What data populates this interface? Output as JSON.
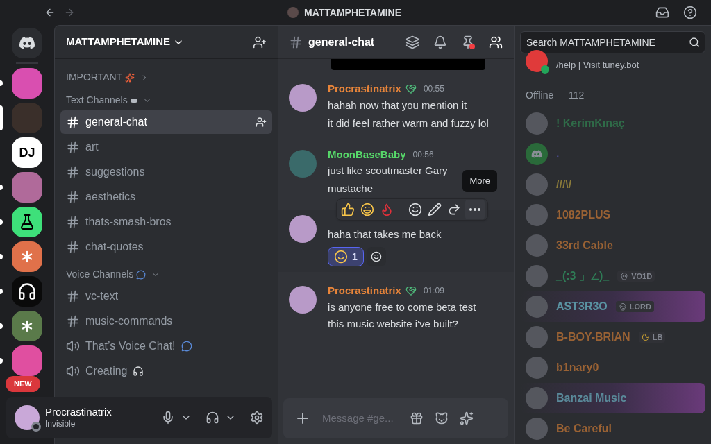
{
  "titlebar": {
    "title": "MATTAMPHETAMINE"
  },
  "servers": [
    {
      "color": "#2b2d31",
      "kind": "home",
      "unread": false,
      "selected": false
    },
    {
      "color": "#d94fb0",
      "kind": "picture",
      "unread": true,
      "selected": false
    },
    {
      "color": "#3a2f2a",
      "kind": "picture",
      "unread": false,
      "selected": true
    },
    {
      "color": "#ffffff",
      "kind": "label",
      "label": "DJ",
      "unread": false,
      "selected": false
    },
    {
      "color": "#b06a9a",
      "kind": "picture",
      "unread": true,
      "selected": false
    },
    {
      "color": "#3ee07a",
      "kind": "flask",
      "unread": true,
      "selected": false
    },
    {
      "color": "#e0714a",
      "kind": "burst",
      "unread": true,
      "selected": false
    },
    {
      "color": "#0a0a0a",
      "kind": "headphones",
      "unread": true,
      "selected": false
    },
    {
      "color": "#5a7a4a",
      "kind": "burst",
      "unread": true,
      "selected": false
    },
    {
      "color": "#e04fa0",
      "kind": "picture",
      "unread": true,
      "selected": false,
      "badge": "NEW"
    }
  ],
  "sidebar": {
    "server_name": "MATTAMPHETAMINE",
    "sections": [
      {
        "title": "IMPORTANT",
        "expanded": false
      },
      {
        "title": "Text Channels",
        "expanded": true,
        "channels": [
          {
            "name": "general-chat",
            "kind": "text",
            "selected": true
          },
          {
            "name": "art",
            "kind": "text",
            "selected": false
          },
          {
            "name": "suggestions",
            "kind": "text",
            "selected": false
          },
          {
            "name": "aesthetics",
            "kind": "text",
            "selected": false
          },
          {
            "name": "thats-smash-bros",
            "kind": "text",
            "selected": false
          },
          {
            "name": "chat-quotes",
            "kind": "text",
            "selected": false
          }
        ]
      },
      {
        "title": "Voice Channels",
        "expanded": true,
        "channels": [
          {
            "name": "vc-text",
            "kind": "text",
            "selected": false
          },
          {
            "name": "music-commands",
            "kind": "text",
            "selected": false
          },
          {
            "name": "That’s Voice Chat!",
            "kind": "voice",
            "selected": false
          },
          {
            "name": "Creating",
            "kind": "voice",
            "selected": false
          }
        ]
      }
    ],
    "user": {
      "name": "Procrastinatrix",
      "status": "Invisible"
    }
  },
  "chat": {
    "channel": "general-chat",
    "pin_alert": true,
    "messages": [
      {
        "author": "Procrastinatrix",
        "color": "#e8853a",
        "time": "00:55",
        "hovered": false,
        "lines": [
          "hahah now that you mention it",
          "it did feel rather warm and fuzzy lol"
        ]
      },
      {
        "author": "MoonBaseBaby",
        "color": "#57d96a",
        "time": "00:56",
        "hovered": false,
        "lines": [
          "just like scoutmaster Gary",
          "mustache"
        ]
      },
      {
        "hovered": true,
        "lines": [
          "haha that takes me back"
        ],
        "reactions": [
          {
            "count": "1",
            "reacted": true
          }
        ]
      },
      {
        "author": "Procrastinatrix",
        "color": "#e8853a",
        "time": "01:09",
        "hovered": false,
        "lines": [
          "is anyone free to come beta test this music website i've built?"
        ]
      }
    ],
    "tooltip": "More",
    "input": {
      "placeholder": "Message #ge..."
    }
  },
  "members": {
    "search": {
      "placeholder": "Search MATTAMPHETAMINE"
    },
    "bot_status": "/help | Visit tuney.bot",
    "group": "Offline — 112",
    "list": [
      {
        "name": "! KerimKınaç",
        "color": "#2f6b48",
        "highlighted": false,
        "kind": "photo"
      },
      {
        "name": ".",
        "color": "#4a4a8a",
        "highlighted": false,
        "kind": "logo"
      },
      {
        "name": "///\\/",
        "color": "#8a7a3a",
        "highlighted": false,
        "kind": "photo"
      },
      {
        "name": "1082PLUS",
        "color": "#9a6234",
        "highlighted": false,
        "kind": "photo"
      },
      {
        "name": "33rd Cable",
        "color": "#9a6234",
        "highlighted": false,
        "kind": "photo"
      },
      {
        "name": "_(:3 」∠)_",
        "color": "#2f7a55",
        "highlighted": false,
        "kind": "photo",
        "tag": {
          "kind": "skull",
          "label": "VO1D"
        }
      },
      {
        "name": "AST3R3O",
        "color": "#5a93a2",
        "highlighted": true,
        "kind": "photo",
        "tag": {
          "kind": "skull",
          "label": "LORD"
        }
      },
      {
        "name": "B-BOY-BRIAN",
        "color": "#9a6234",
        "highlighted": false,
        "kind": "photo",
        "tag": {
          "kind": "moon",
          "label": "LB"
        }
      },
      {
        "name": "b1nary0",
        "color": "#9a6234",
        "highlighted": false,
        "kind": "photo"
      },
      {
        "name": "Banzai Music",
        "color": "#5a8a9a",
        "highlighted": true,
        "kind": "photo"
      },
      {
        "name": "Be Careful",
        "color": "#9a6234",
        "highlighted": false,
        "kind": "photo"
      }
    ]
  }
}
